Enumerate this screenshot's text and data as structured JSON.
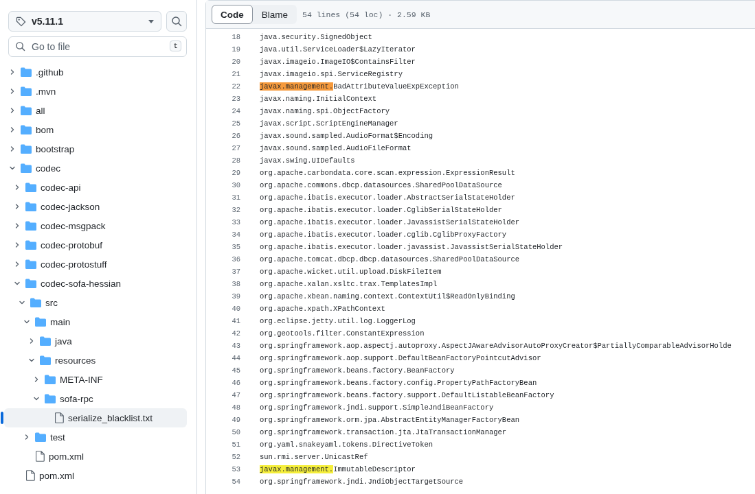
{
  "sidebar": {
    "branch": {
      "label": "v5.11.1"
    },
    "file_search": {
      "placeholder": "Go to file",
      "shortcut": "t"
    },
    "tree": [
      {
        "name": ".github",
        "kind": "folder",
        "expanded": false,
        "selected": false
      },
      {
        "name": ".mvn",
        "kind": "folder",
        "expanded": false,
        "selected": false
      },
      {
        "name": "all",
        "kind": "folder",
        "expanded": false,
        "selected": false
      },
      {
        "name": "bom",
        "kind": "folder",
        "expanded": false,
        "selected": false
      },
      {
        "name": "bootstrap",
        "kind": "folder",
        "expanded": false,
        "selected": false
      },
      {
        "name": "codec",
        "kind": "folder",
        "expanded": true,
        "selected": false,
        "children": [
          {
            "name": "codec-api",
            "kind": "folder",
            "expanded": false,
            "selected": false
          },
          {
            "name": "codec-jackson",
            "kind": "folder",
            "expanded": false,
            "selected": false
          },
          {
            "name": "codec-msgpack",
            "kind": "folder",
            "expanded": false,
            "selected": false
          },
          {
            "name": "codec-protobuf",
            "kind": "folder",
            "expanded": false,
            "selected": false
          },
          {
            "name": "codec-protostuff",
            "kind": "folder",
            "expanded": false,
            "selected": false
          },
          {
            "name": "codec-sofa-hessian",
            "kind": "folder",
            "expanded": true,
            "selected": false,
            "children": [
              {
                "name": "src",
                "kind": "folder",
                "expanded": true,
                "selected": false,
                "children": [
                  {
                    "name": "main",
                    "kind": "folder",
                    "expanded": true,
                    "selected": false,
                    "children": [
                      {
                        "name": "java",
                        "kind": "folder",
                        "expanded": false,
                        "selected": false
                      },
                      {
                        "name": "resources",
                        "kind": "folder",
                        "expanded": true,
                        "selected": false,
                        "children": [
                          {
                            "name": "META-INF",
                            "kind": "folder",
                            "expanded": false,
                            "selected": false
                          },
                          {
                            "name": "sofa-rpc",
                            "kind": "folder",
                            "expanded": true,
                            "selected": false,
                            "children": [
                              {
                                "name": "serialize_blacklist.txt",
                                "kind": "file",
                                "selected": true
                              }
                            ]
                          }
                        ]
                      }
                    ]
                  },
                  {
                    "name": "test",
                    "kind": "folder",
                    "expanded": false,
                    "selected": false
                  }
                ]
              },
              {
                "name": "pom.xml",
                "kind": "file",
                "selected": false
              }
            ]
          }
        ]
      },
      {
        "name": "pom.xml",
        "kind": "file",
        "selected": false
      }
    ]
  },
  "viewer": {
    "tabs": [
      {
        "label": "Code",
        "selected": true
      },
      {
        "label": "Blame",
        "selected": false
      }
    ],
    "info": "54 lines (54 loc) · 2.59 KB",
    "lines": [
      {
        "number": "18",
        "text": "java.security.SignedObject"
      },
      {
        "number": "19",
        "text": "java.util.ServiceLoader$LazyIterator"
      },
      {
        "number": "20",
        "text": "javax.imageio.ImageIO$ContainsFilter"
      },
      {
        "number": "21",
        "text": "javax.imageio.spi.ServiceRegistry"
      },
      {
        "number": "22",
        "match": {
          "text": "javax.management.",
          "color": "#f69a3c"
        },
        "text": "BadAttributeValueExpException"
      },
      {
        "number": "23",
        "text": "javax.naming.InitialContext"
      },
      {
        "number": "24",
        "text": "javax.naming.spi.ObjectFactory"
      },
      {
        "number": "25",
        "text": "javax.script.ScriptEngineManager"
      },
      {
        "number": "26",
        "text": "javax.sound.sampled.AudioFormat$Encoding"
      },
      {
        "number": "27",
        "text": "javax.sound.sampled.AudioFileFormat"
      },
      {
        "number": "28",
        "text": "javax.swing.UIDefaults"
      },
      {
        "number": "29",
        "text": "org.apache.carbondata.core.scan.expression.ExpressionResult"
      },
      {
        "number": "30",
        "text": "org.apache.commons.dbcp.datasources.SharedPoolDataSource"
      },
      {
        "number": "31",
        "text": "org.apache.ibatis.executor.loader.AbstractSerialStateHolder"
      },
      {
        "number": "32",
        "text": "org.apache.ibatis.executor.loader.CglibSerialStateHolder"
      },
      {
        "number": "33",
        "text": "org.apache.ibatis.executor.loader.JavassistSerialStateHolder"
      },
      {
        "number": "34",
        "text": "org.apache.ibatis.executor.loader.cglib.CglibProxyFactory"
      },
      {
        "number": "35",
        "text": "org.apache.ibatis.executor.loader.javassist.JavassistSerialStateHolder"
      },
      {
        "number": "36",
        "text": "org.apache.tomcat.dbcp.dbcp.datasources.SharedPoolDataSource"
      },
      {
        "number": "37",
        "text": "org.apache.wicket.util.upload.DiskFileItem"
      },
      {
        "number": "38",
        "text": "org.apache.xalan.xsltc.trax.TemplatesImpl"
      },
      {
        "number": "39",
        "text": "org.apache.xbean.naming.context.ContextUtil$ReadOnlyBinding"
      },
      {
        "number": "40",
        "text": "org.apache.xpath.XPathContext"
      },
      {
        "number": "41",
        "text": "org.eclipse.jetty.util.log.LoggerLog"
      },
      {
        "number": "42",
        "text": "org.geotools.filter.ConstantExpression"
      },
      {
        "number": "43",
        "text": "org.springframework.aop.aspectj.autoproxy.AspectJAwareAdvisorAutoProxyCreator$PartiallyComparableAdvisorHolde"
      },
      {
        "number": "44",
        "text": "org.springframework.aop.support.DefaultBeanFactoryPointcutAdvisor"
      },
      {
        "number": "45",
        "text": "org.springframework.beans.factory.BeanFactory"
      },
      {
        "number": "46",
        "text": "org.springframework.beans.factory.config.PropertyPathFactoryBean"
      },
      {
        "number": "47",
        "text": "org.springframework.beans.factory.support.DefaultListableBeanFactory"
      },
      {
        "number": "48",
        "text": "org.springframework.jndi.support.SimpleJndiBeanFactory"
      },
      {
        "number": "49",
        "text": "org.springframework.orm.jpa.AbstractEntityManagerFactoryBean"
      },
      {
        "number": "50",
        "text": "org.springframework.transaction.jta.JtaTransactionManager"
      },
      {
        "number": "51",
        "text": "org.yaml.snakeyaml.tokens.DirectiveToken"
      },
      {
        "number": "52",
        "text": "sun.rmi.server.UnicastRef"
      },
      {
        "number": "53",
        "match": {
          "text": "javax.management.",
          "color": "#f5ee3b"
        },
        "text": "ImmutableDescriptor"
      },
      {
        "number": "54",
        "text": "org.springframework.jndi.JndiObjectTargetSource"
      }
    ]
  }
}
